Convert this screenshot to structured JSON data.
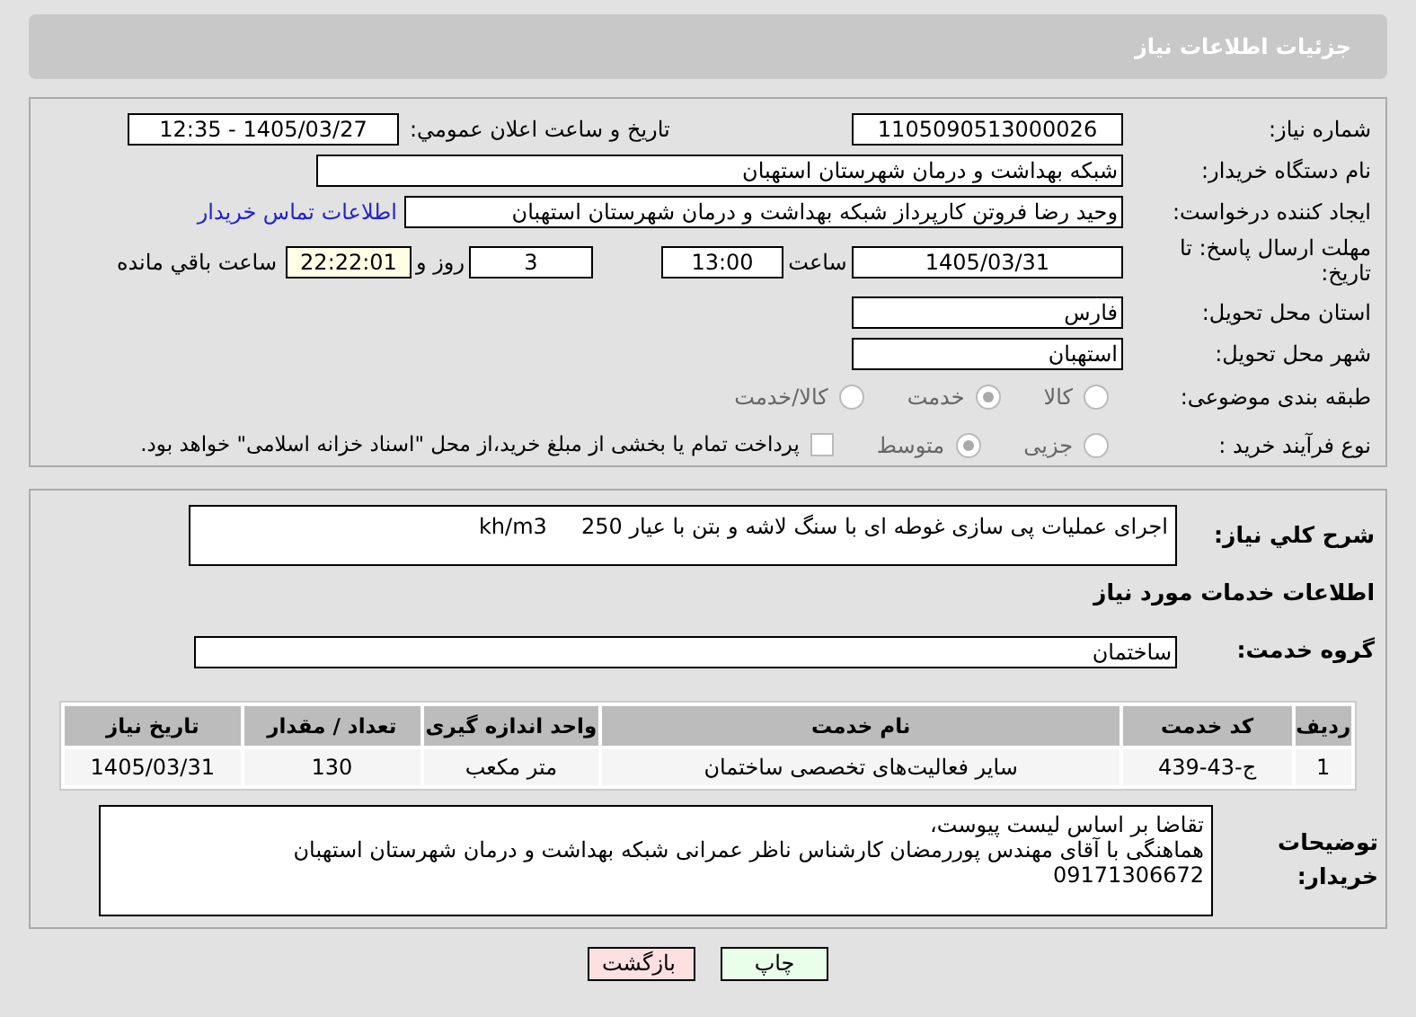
{
  "header": {
    "title": "جزئیات اطلاعات نیاز"
  },
  "details": {
    "need_number": {
      "label": "شماره نیاز:",
      "value": "1105090513000026"
    },
    "announce": {
      "label": "تاریخ و ساعت اعلان عمومي:",
      "value": "1405/03/27 - 12:35"
    },
    "buyer": {
      "label": "نام دستگاه خریدار:",
      "value": "شبکه بهداشت و درمان شهرستان استهبان"
    },
    "creator": {
      "label": "ایجاد کننده درخواست:",
      "value": "وحید رضا فروتن کارپرداز شبکه بهداشت و درمان شهرستان استهبان",
      "link": "اطلاعات تماس خریدار"
    },
    "deadline": {
      "label": "مهلت ارسال پاسخ: تا تاریخ:",
      "date": "1405/03/31",
      "time_label": "ساعت",
      "time": "13:00",
      "days": "3",
      "days_label": "روز و",
      "remaining": "22:22:01",
      "remaining_label": "ساعت باقي مانده"
    },
    "province": {
      "label": "استان محل تحویل:",
      "value": "فارس"
    },
    "city": {
      "label": "شهر محل تحویل:",
      "value": "استهبان"
    },
    "category": {
      "label": "طبقه بندی موضوعی:",
      "options": [
        {
          "label": "کالا",
          "selected": false
        },
        {
          "label": "خدمت",
          "selected": true
        },
        {
          "label": "کالا/خدمت",
          "selected": false
        }
      ]
    },
    "process": {
      "label": "نوع فرآیند خرید :",
      "options": [
        {
          "label": "جزیی",
          "selected": false
        },
        {
          "label": "متوسط",
          "selected": true
        }
      ],
      "payment": {
        "label": "پرداخت تمام یا بخشی از مبلغ خرید،از محل \"اسناد خزانه اسلامی\" خواهد بود.",
        "checked": false
      }
    }
  },
  "services": {
    "description": {
      "label": "شرح کلي نیاز:",
      "value": "اجرای عملیات پی سازی غوطه ای با سنگ لاشه و بتن با عیار 250     kh/m3"
    },
    "section_title": "اطلاعات خدمات مورد نیاز",
    "group": {
      "label": "گروه خدمت:",
      "value": "ساختمان"
    },
    "table": {
      "columns": [
        "ردیف",
        "کد خدمت",
        "نام خدمت",
        "واحد اندازه گیری",
        "تعداد / مقدار",
        "تاریخ نیاز"
      ],
      "rows": [
        [
          "1",
          "ج-43-439",
          "سایر فعالیت‌های تخصصی ساختمان",
          "متر مکعب",
          "130",
          "1405/03/31"
        ]
      ]
    },
    "notes": {
      "label": "توضیحات خریدار:",
      "lines": [
        "تقاضا بر اساس لیست پیوست،",
        "هماهنگی با آقای مهندس پوررمضان کارشناس ناظر عمرانی شبکه بهداشت و درمان شهرستان استهبان",
        "09171306672"
      ]
    }
  },
  "buttons": [
    {
      "label": "چاپ",
      "kind": "print"
    },
    {
      "label": "بازگشت",
      "kind": "back"
    }
  ]
}
